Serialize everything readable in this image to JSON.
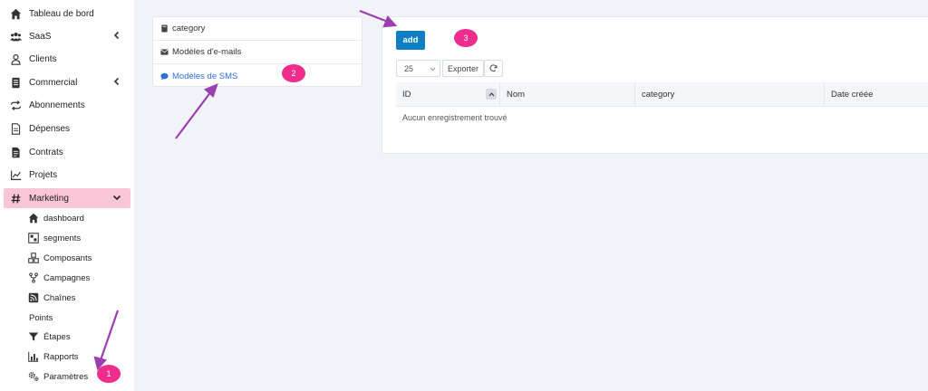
{
  "sidebar": {
    "items": [
      {
        "label": "Tableau de bord",
        "icon": "home-icon"
      },
      {
        "label": "SaaS",
        "icon": "users-icon",
        "chevron": "chevron-left-icon"
      },
      {
        "label": "Clients",
        "icon": "user-icon"
      },
      {
        "label": "Commercial",
        "icon": "file-invoice-icon",
        "chevron": "chevron-left-icon"
      },
      {
        "label": "Abonnements",
        "icon": "repeat-icon"
      },
      {
        "label": "Dépenses",
        "icon": "file-text-icon"
      },
      {
        "label": "Contrats",
        "icon": "contract-icon"
      },
      {
        "label": "Projets",
        "icon": "chart-line-icon"
      },
      {
        "label": "Marketing",
        "icon": "hashtag-icon",
        "chevron": "chevron-down-icon",
        "active": true
      }
    ],
    "subitems": [
      {
        "label": "dashboard",
        "icon": "home-icon"
      },
      {
        "label": "segments",
        "icon": "segments-icon"
      },
      {
        "label": "Composants",
        "icon": "cubes-icon"
      },
      {
        "label": "Campagnes",
        "icon": "fork-icon"
      },
      {
        "label": "Chaînes",
        "icon": "rss-icon"
      },
      {
        "label": "Points",
        "icon": ""
      },
      {
        "label": "Étapes",
        "icon": "filter-icon"
      },
      {
        "label": "Rapports",
        "icon": "bar-chart-icon"
      },
      {
        "label": "Paramètres",
        "icon": "gears-icon"
      }
    ],
    "active_color": "#f8c6d6"
  },
  "menu_panel": {
    "items": [
      {
        "label": "category",
        "icon": "book-icon"
      },
      {
        "label": "Modèles d'e-mails",
        "icon": "envelope-icon"
      },
      {
        "label": "Modèles de SMS",
        "icon": "comment-icon",
        "active": true
      }
    ],
    "active_color": "#2f6fd6"
  },
  "toolbar": {
    "add_label": "add",
    "page_size": "25",
    "export_label": "Exporter",
    "refresh_icon": "refresh-icon",
    "accent": "#0d7fc2"
  },
  "table": {
    "columns": [
      "ID",
      "Nom",
      "category",
      "Date créée"
    ],
    "empty_message": "Aucun enregistrement trouvé"
  },
  "annotations": {
    "badges": [
      "1",
      "2",
      "3"
    ],
    "badge_color": "#ee2d8c",
    "arrow_color": "#9b3fb0"
  }
}
